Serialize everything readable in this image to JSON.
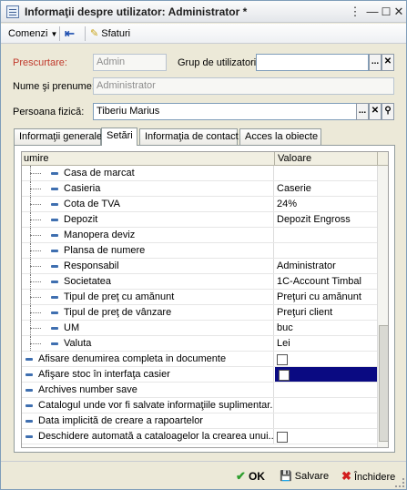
{
  "window": {
    "title": "Informaţii despre utilizator: Administrator *"
  },
  "toolbar": {
    "commands_label": "Comenzi",
    "tips_label": "Sfaturi"
  },
  "form": {
    "short_name_label": "Prescurtare:",
    "short_name_value": "Admin",
    "user_group_label": "Grup de utilizatori:",
    "user_group_value": "",
    "full_name_label": "Nume şi prenume:",
    "full_name_value": "Administrator",
    "person_label": "Persoana fizică:",
    "person_value": "Tiberiu Marius"
  },
  "tabs": [
    {
      "label": "Informaţii generale"
    },
    {
      "label": "Setări"
    },
    {
      "label": "Informaţia de contact"
    },
    {
      "label": "Acces la obiecte"
    }
  ],
  "grid": {
    "col_name": "umire",
    "col_value": "Valoare",
    "rows": [
      {
        "name": "Casa de marcat",
        "value": ""
      },
      {
        "name": "Casieria",
        "value": "Caserie"
      },
      {
        "name": "Cota de TVA",
        "value": "24%"
      },
      {
        "name": "Depozit",
        "value": "Depozit Engross"
      },
      {
        "name": "Manopera deviz",
        "value": ""
      },
      {
        "name": "Plansa de numere",
        "value": ""
      },
      {
        "name": "Responsabil",
        "value": "Administrator"
      },
      {
        "name": "Societatea",
        "value": "1C-Account Timbal"
      },
      {
        "name": "Tipul de preţ cu amănunt",
        "value": "Preţuri cu amănunt"
      },
      {
        "name": "Tipul de preţ de vânzare",
        "value": "Preţuri client"
      },
      {
        "name": "UM",
        "value": "buc"
      },
      {
        "name": "Valuta",
        "value": "Lei"
      },
      {
        "name": "Afisare denumirea completa in documente",
        "value": ""
      },
      {
        "name": "Afişare stoc în interfaţa casier",
        "value": ""
      },
      {
        "name": "Archives number save",
        "value": ""
      },
      {
        "name": "Catalogul unde vor fi salvate informaţiile suplimentar...",
        "value": ""
      },
      {
        "name": "Data implicită de creare a rapoartelor",
        "value": ""
      },
      {
        "name": "Deschidere automată a cataloagelor la crearea unui...",
        "value": ""
      }
    ]
  },
  "bottom": {
    "ok_label": "OK",
    "save_label": "Salvare",
    "close_label": "Închidere"
  },
  "colors": {
    "accent_label": "#c0392b",
    "selection": "#0a0a82",
    "ok_check": "#2e9e2e",
    "close_x": "#d21e1e"
  }
}
